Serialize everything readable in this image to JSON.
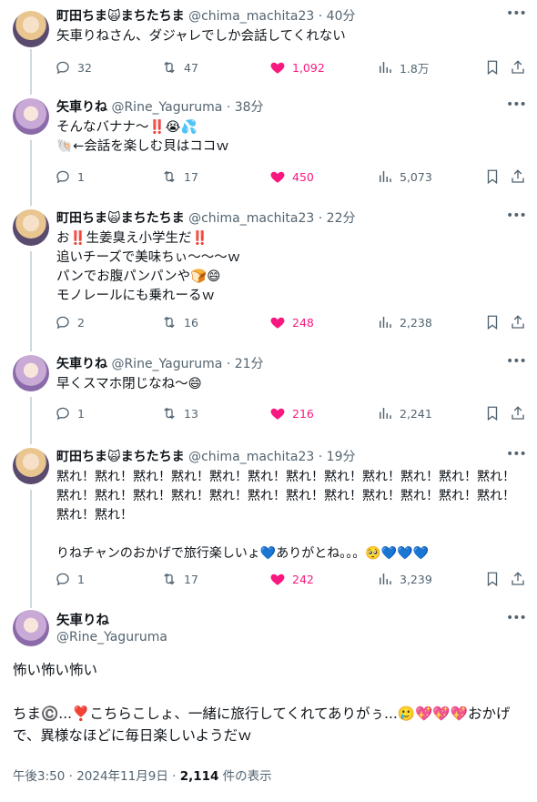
{
  "tweets": [
    {
      "name": "町田ちま🙀まちたちま",
      "handle": "@chima_machita23",
      "time": "40分",
      "text": "矢車りねさん、ダジャレでしか会話してくれない",
      "replies": "32",
      "retweets": "47",
      "likes": "1,092",
      "views": "1.8万"
    },
    {
      "name": "矢車りね",
      "handle": "@Rine_Yaguruma",
      "time": "38分",
      "text": "そんなバナナ〜‼️😭💦\n🐚←会話を楽しむ貝はココｗ",
      "replies": "1",
      "retweets": "17",
      "likes": "450",
      "views": "5,073"
    },
    {
      "name": "町田ちま🙀まちたちま",
      "handle": "@chima_machita23",
      "time": "22分",
      "text": "お‼️生姜臭え小学生だ‼️\n追いチーズで美味ちぃ〜〜〜ｗ\nパンでお腹パンパンや🍞😄\nモノレールにも乗れーるｗ",
      "replies": "2",
      "retweets": "16",
      "likes": "248",
      "views": "2,238"
    },
    {
      "name": "矢車りね",
      "handle": "@Rine_Yaguruma",
      "time": "21分",
      "text": "早くスマホ閉じなね〜😄",
      "replies": "1",
      "retweets": "13",
      "likes": "216",
      "views": "2,241"
    },
    {
      "name": "町田ちま🙀まちたちま",
      "handle": "@chima_machita23",
      "time": "19分",
      "text": "黙れ！黙れ！黙れ！黙れ！黙れ！黙れ！黙れ！黙れ！黙れ！黙れ！黙れ！黙れ！黙れ！黙れ！黙れ！黙れ！黙れ！黙れ！黙れ！黙れ！黙れ！黙れ！黙れ！黙れ！黙れ！黙れ！\n\nりねチャンのおかげで旅行楽しいょ💙ありがとね。。。🥺💙💙💙",
      "replies": "1",
      "retweets": "17",
      "likes": "242",
      "views": "3,239"
    }
  ],
  "focus": {
    "name": "矢車りね",
    "handle": "@Rine_Yaguruma",
    "text": "怖い怖い怖い\n\nちま©️...❣️こちらこしょ、一緒に旅行してくれてありがぅ...🥲💖💖💖おかげで、異様なほどに毎日楽しいようだｗ",
    "timestamp": "午後3:50 · 2024年11月9日 · ",
    "view_count": "2,114",
    "view_label": " 件の表示"
  },
  "colors": {
    "like": "#f91880",
    "muted": "#536471",
    "thread_line": "#cfd9de"
  }
}
